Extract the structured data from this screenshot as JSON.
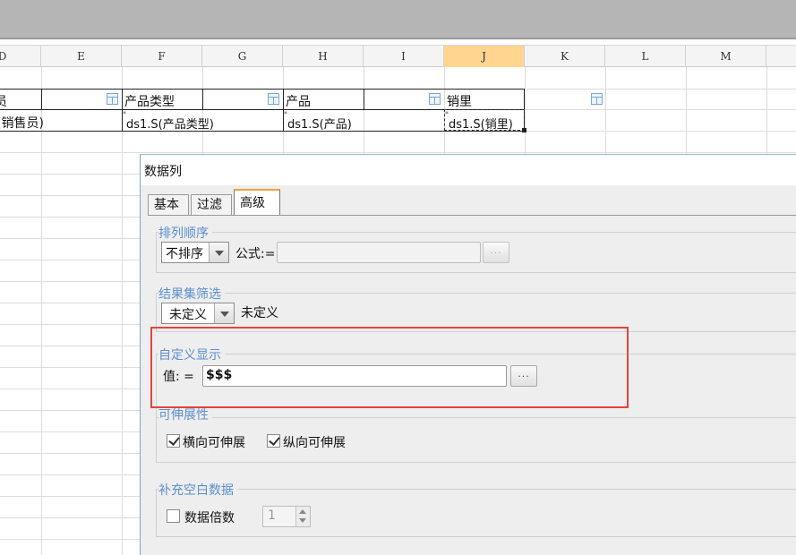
{
  "columns": [
    "D",
    "E",
    "F",
    "G",
    "H",
    "I",
    "J",
    "K",
    "L",
    "M"
  ],
  "selected_column": "J",
  "sheet": {
    "header_row": {
      "d": "员",
      "f": "产品类型",
      "h": "产品",
      "j": "销里"
    },
    "data_row": {
      "d": "(销售员)",
      "f": "ds1.S(产品类型)",
      "h": "ds1.S(产品)",
      "j": "ds1.S(销里)"
    }
  },
  "dialog": {
    "title": "数据列",
    "tabs": [
      {
        "label": "基本",
        "active": false
      },
      {
        "label": "过滤",
        "active": false
      },
      {
        "label": "高级",
        "active": true
      }
    ],
    "sort": {
      "legend": "排列顺序",
      "select_value": "不排序",
      "formula_label": "公式:=",
      "formula_value": "",
      "button_label": "..."
    },
    "result_filter": {
      "legend": "结果集筛选",
      "select_value": "未定义",
      "status_text": "未定义"
    },
    "custom_display": {
      "legend": "自定义显示",
      "value_label": "值: =",
      "value": "$$$",
      "button_label": "..."
    },
    "extensibility": {
      "legend": "可伸展性",
      "horizontal_label": "横向可伸展",
      "horizontal_checked": true,
      "vertical_label": "纵向可伸展",
      "vertical_checked": true
    },
    "fill_blank": {
      "legend": "补充空白数据",
      "multiple_label": "数据倍数",
      "multiple_checked": false,
      "multiple_value": "1"
    }
  },
  "colors": {
    "selected_column": "#ffd58f",
    "legend_text": "#5b8fd0",
    "highlight": "#e0443e",
    "active_tab_accent": "#f0a23a"
  }
}
